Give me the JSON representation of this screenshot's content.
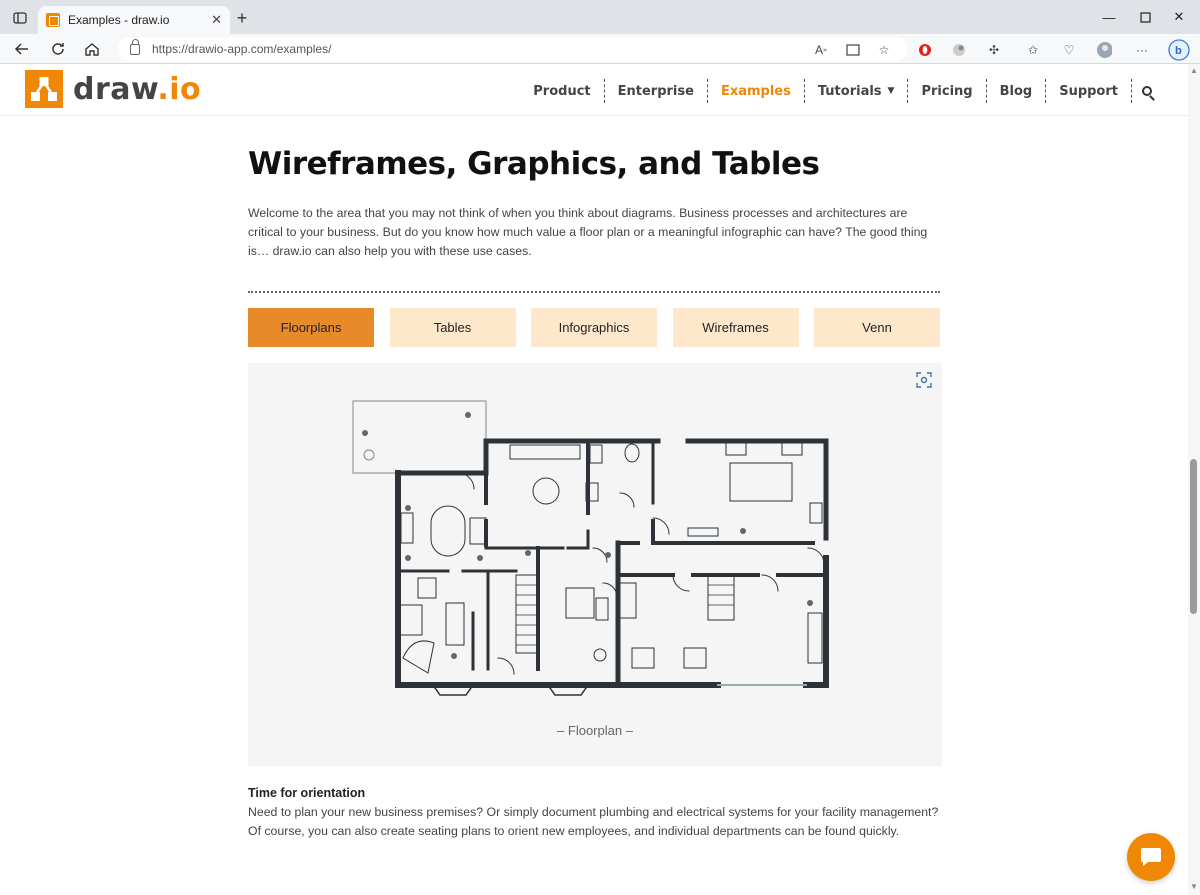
{
  "browser": {
    "tab_title": "Examples - draw.io",
    "url": "https://drawio-app.com/examples/"
  },
  "site": {
    "logo_text_main": "draw",
    "logo_text_dot": ".io",
    "nav": [
      {
        "label": "Product"
      },
      {
        "label": "Enterprise"
      },
      {
        "label": "Examples",
        "active": true
      },
      {
        "label": "Tutorials",
        "has_dropdown": true
      },
      {
        "label": "Pricing"
      },
      {
        "label": "Blog"
      },
      {
        "label": "Support"
      }
    ]
  },
  "main": {
    "title": "Wireframes, Graphics, and Tables",
    "intro": "Welcome to the area that you may not think of when you think about diagrams. Business processes and architectures are critical to your business. But do you know how much value a floor plan or a meaningful infographic can have? The good thing is… draw.io can also help you with these use cases.",
    "tabs": [
      {
        "label": "Floorplans",
        "active": true
      },
      {
        "label": "Tables"
      },
      {
        "label": "Infographics"
      },
      {
        "label": "Wireframes"
      },
      {
        "label": "Venn"
      }
    ],
    "figure_caption": "– Floorplan –",
    "section_title": "Time for orientation",
    "section_text": "Need to plan your new business premises? Or simply document plumbing and electrical systems for your facility management? Of course, you can also create seating plans to orient new employees, and individual departments can be found quickly."
  },
  "colors": {
    "brand": "#f08705",
    "tab_active": "#e98a2a",
    "tab_inactive": "#fde8cc",
    "wall": "#2d3238"
  }
}
